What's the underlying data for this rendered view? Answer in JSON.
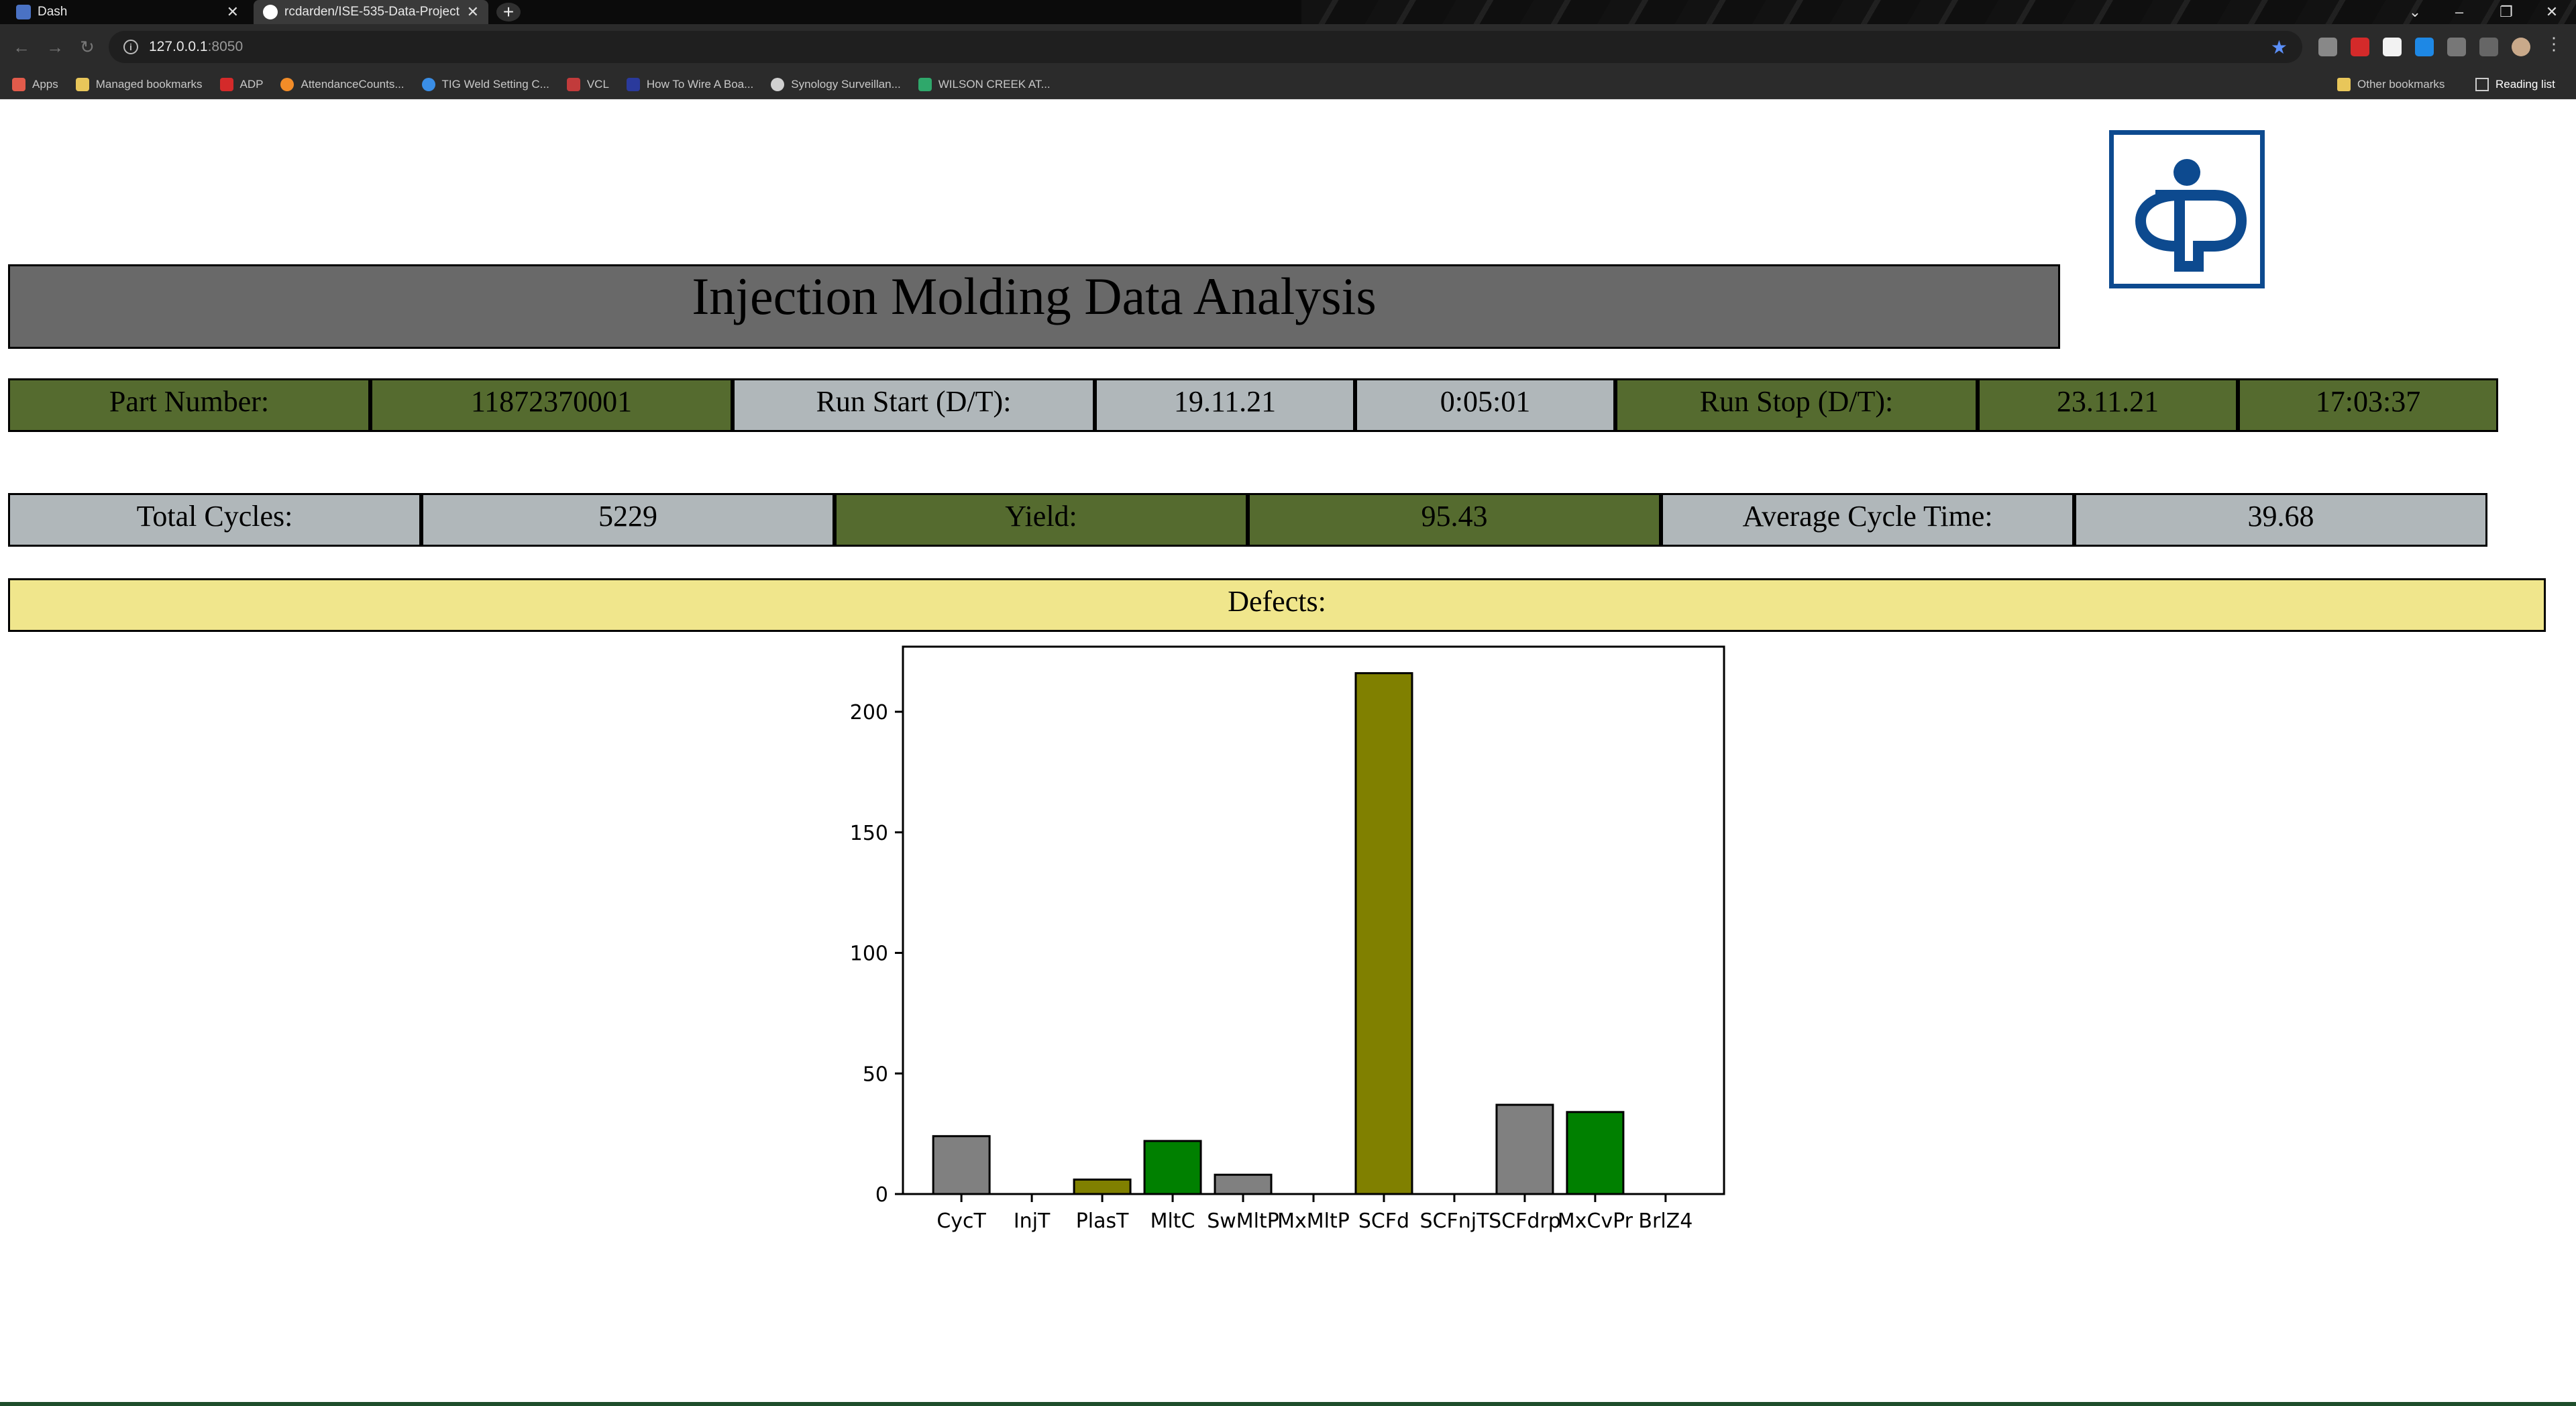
{
  "browser": {
    "tabs": [
      {
        "label": "Dash",
        "favicon_color": "#4a72c4"
      },
      {
        "label": "rcdarden/ISE-535-Data-Project a",
        "favicon_color": "#ffffff"
      }
    ],
    "url_host": "127.0.0.1",
    "url_port": ":8050",
    "bookmarks": [
      {
        "label": "Apps",
        "color": "#e25b4b"
      },
      {
        "label": "Managed bookmarks",
        "color": "#e8c65a"
      },
      {
        "label": "ADP",
        "color": "#d42a2a"
      },
      {
        "label": "AttendanceCounts...",
        "color": "#f28c28"
      },
      {
        "label": "TIG Weld Setting C...",
        "color": "#3a8ee6"
      },
      {
        "label": "VCL",
        "color": "#c23b3b"
      },
      {
        "label": "How To Wire A Boa...",
        "color": "#2a3a9c"
      },
      {
        "label": "Synology Surveillan...",
        "color": "#d0d0d0"
      },
      {
        "label": "WILSON CREEK AT...",
        "color": "#2fa86b"
      }
    ],
    "other_bookmarks": "Other bookmarks",
    "reading_list": "Reading list"
  },
  "page": {
    "title": "Injection Molding Data Analysis",
    "run_info": {
      "part_number_label": "Part Number:",
      "part_number": "11872370001",
      "run_start_label": "Run Start (D/T):",
      "run_start_date": "19.11.21",
      "run_start_time": "0:05:01",
      "run_stop_label": "Run Stop (D/T):",
      "run_stop_date": "23.11.21",
      "run_stop_time": "17:03:37"
    },
    "summary": {
      "total_cycles_label": "Total Cycles:",
      "total_cycles": "5229",
      "yield_label": "Yield:",
      "yield": "95.43",
      "avg_cycle_label": "Average Cycle Time:",
      "avg_cycle": "39.68"
    },
    "defects_label": "Defects:",
    "colors": {
      "green": "#556b2f",
      "silver": "#b0b7ba",
      "khaki": "#f0e68c",
      "title_bg": "#696969",
      "logo_blue": "#0d4a8f"
    }
  },
  "chart_data": {
    "type": "bar",
    "categories": [
      "CycT",
      "InjT",
      "PlasT",
      "MltC",
      "SwMltP",
      "MxMltP",
      "SCFd",
      "SCFnjT",
      "SCFdrp",
      "MxCvPr",
      "BrlZ4"
    ],
    "values": [
      24,
      0,
      6,
      22,
      8,
      0,
      216,
      0,
      37,
      34,
      0
    ],
    "colors": [
      "#808080",
      "#808000",
      "#808000",
      "#008000",
      "#808080",
      "#808000",
      "#808000",
      "#008000",
      "#808080",
      "#008000",
      "#808080"
    ],
    "ylim": [
      0,
      227
    ],
    "yticks": [
      0,
      50,
      100,
      150,
      200
    ]
  }
}
